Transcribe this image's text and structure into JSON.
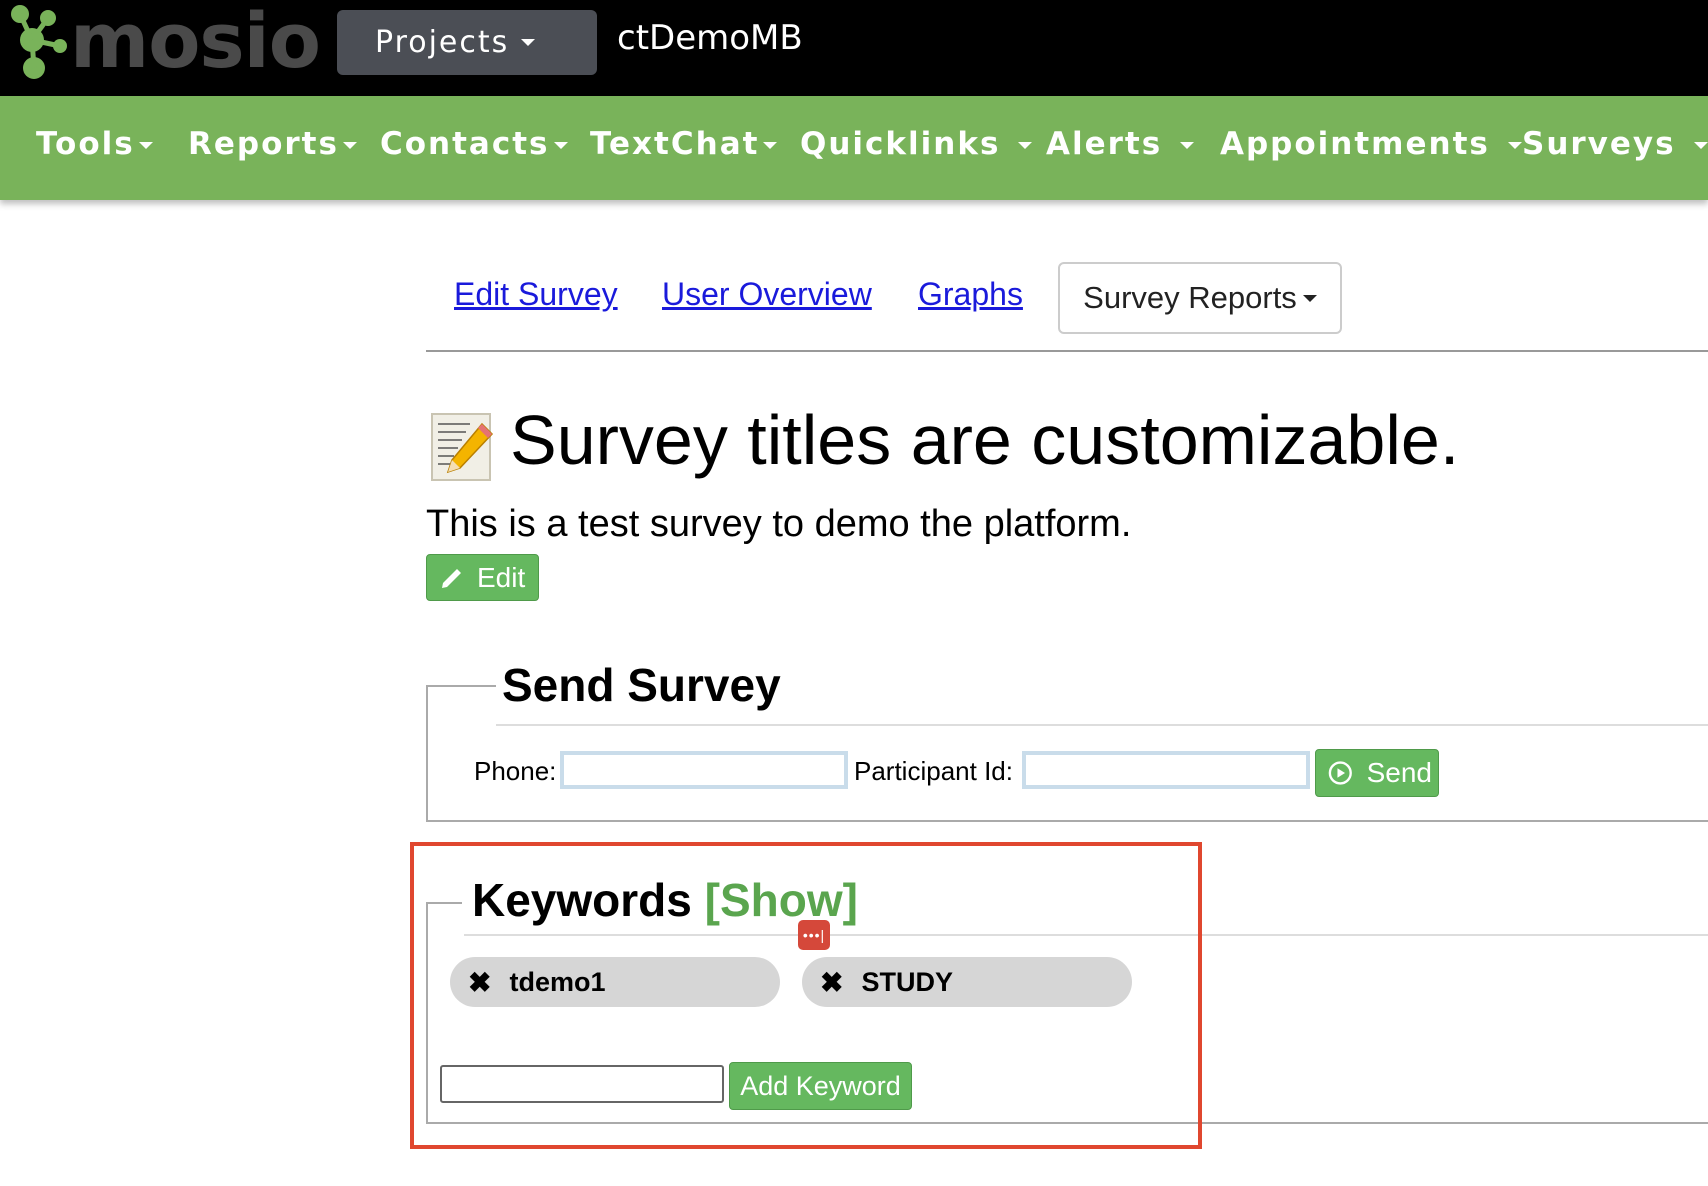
{
  "brand": {
    "logo_text": "mosio"
  },
  "topbar": {
    "projects_label": "Projects",
    "project_name": "ctDemoMB"
  },
  "nav": {
    "items": [
      {
        "label": "Tools"
      },
      {
        "label": "Reports"
      },
      {
        "label": "Contacts"
      },
      {
        "label": "TextChat"
      },
      {
        "label": "Quicklinks"
      },
      {
        "label": "Alerts"
      },
      {
        "label": "Appointments"
      },
      {
        "label": "Surveys"
      }
    ]
  },
  "subtabs": {
    "edit_survey": "Edit Survey",
    "user_overview": "User Overview",
    "graphs": "Graphs",
    "survey_reports": "Survey Reports"
  },
  "survey": {
    "title": "Survey titles are customizable.",
    "description": "This is a test survey to demo the platform.",
    "edit_label": "Edit"
  },
  "send_survey": {
    "legend": "Send Survey",
    "phone_label": "Phone:",
    "phone_value": "",
    "participant_label": "Participant Id:",
    "participant_value": "",
    "send_label": "Send"
  },
  "keywords": {
    "legend": "Keywords",
    "show_link": "[Show]",
    "items": [
      {
        "label": "tdemo1"
      },
      {
        "label": "STUDY"
      }
    ],
    "input_value": "",
    "add_label": "Add Keyword"
  },
  "colors": {
    "nav_green": "#79b35a",
    "button_green": "#65b85f",
    "highlight_red": "#e0472f",
    "link_blue": "#1a1adb"
  }
}
